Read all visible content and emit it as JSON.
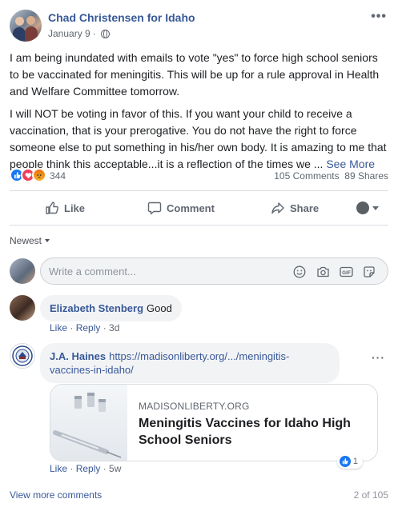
{
  "post": {
    "page_name": "Chad Christensen for Idaho",
    "date": "January 9",
    "separator": "·",
    "more": "•••",
    "paragraph1": "I am being inundated with emails to vote \"yes\" to force high school seniors to be vaccinated for meningitis. This will be up for a rule approval in Health and Welfare Committee tomorrow.",
    "paragraph2": "I will NOT be voting in favor of this. If you want your child to receive a vaccination, that is your prerogative. You do not have the right to force someone else to put something in his/her own body. It is amazing to me that people think this acceptable...it is a reflection of the times we ...",
    "see_more": "See More"
  },
  "stats": {
    "reaction_count": "344",
    "comments": "105 Comments",
    "shares": "89 Shares",
    "reaction_types": [
      "like-icon",
      "love-icon",
      "angry-icon"
    ]
  },
  "actions": {
    "like": "Like",
    "comment": "Comment",
    "share": "Share"
  },
  "sort": {
    "label": "Newest"
  },
  "composer": {
    "placeholder": "Write a comment..."
  },
  "comments": [
    {
      "author": "Elizabeth Stenberg",
      "text": "Good",
      "like": "Like",
      "reply": "Reply",
      "time": "3d"
    },
    {
      "author": "J.A. Haines",
      "link_text": "https://madisonliberty.org/.../meningitis-vaccines-in-idaho/",
      "card_domain": "MADISONLIBERTY.ORG",
      "card_title": "Meningitis Vaccines for Idaho High School Seniors",
      "like": "Like",
      "reply": "Reply",
      "time": "5w",
      "reaction_count": "1"
    }
  ],
  "footer": {
    "view_more": "View more comments",
    "page_count": "2 of 105"
  },
  "colors": {
    "link": "#385898",
    "like_blue": "#1877f2",
    "love_red": "#f33e58",
    "angry_yellow": "#f7b125"
  }
}
